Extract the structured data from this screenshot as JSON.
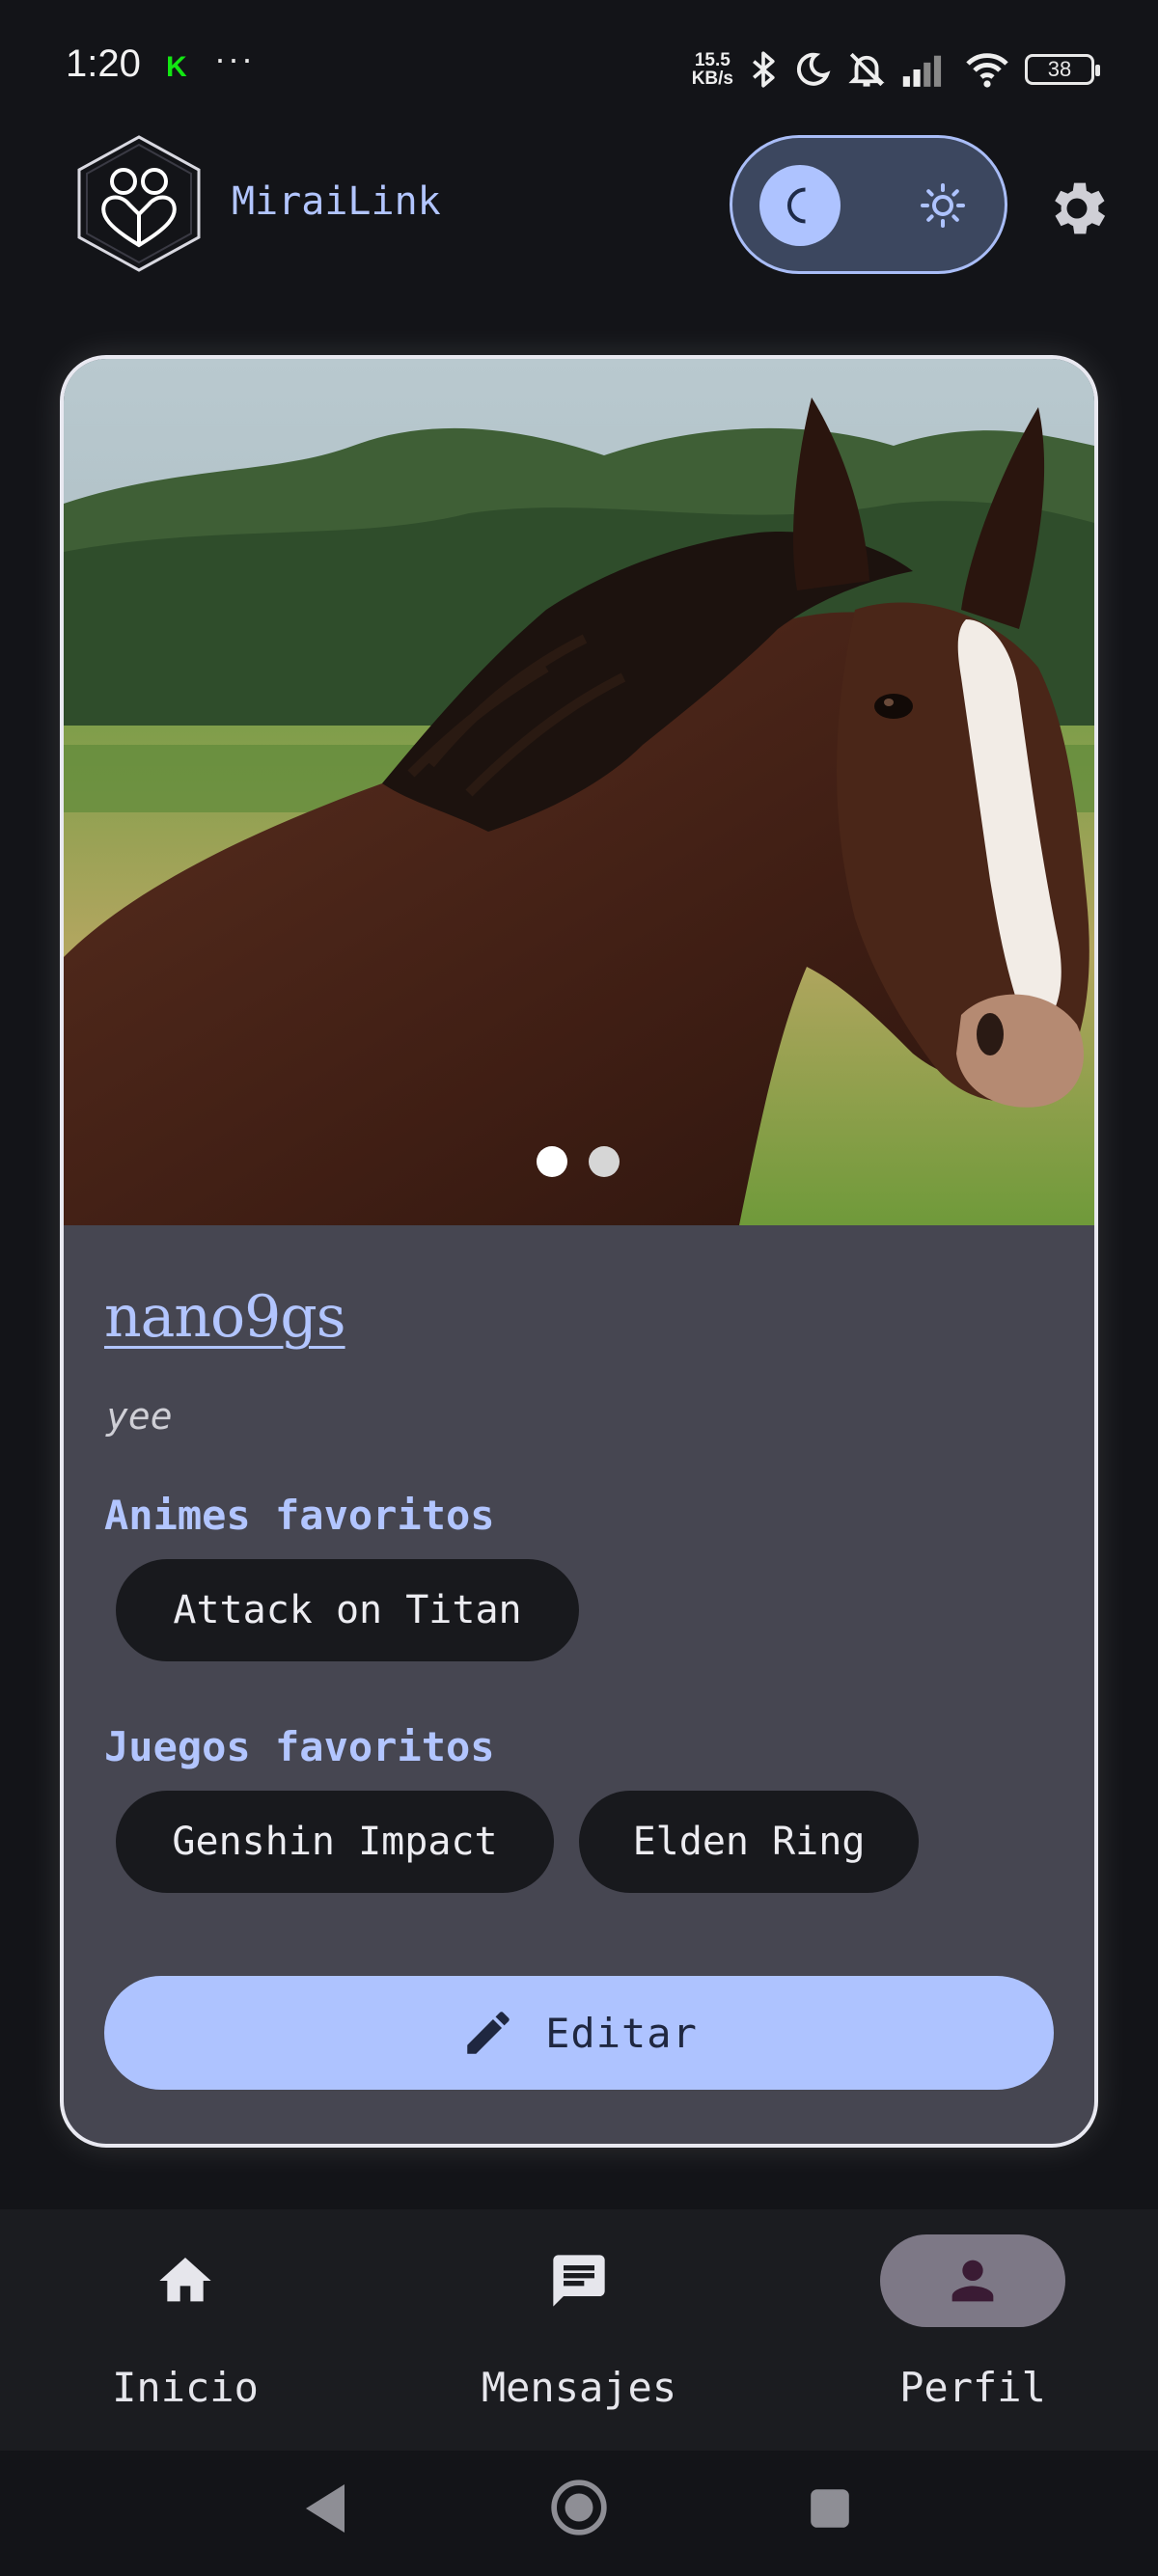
{
  "status_bar": {
    "time": "1:20",
    "notification_icon": "K",
    "more": "···",
    "net_speed_top": "15.5",
    "net_speed_bottom": "KB/s",
    "battery": "38"
  },
  "app_bar": {
    "title": "MiraiLink",
    "logo_icon": "couple-heart-hexagon-icon",
    "theme_toggle": {
      "selected": "dark",
      "icons": [
        "moon-icon",
        "sun-icon"
      ]
    },
    "settings_icon": "gear-icon"
  },
  "profile": {
    "username": "nano9gs",
    "bio": "yee",
    "photo_pager": {
      "count": 2,
      "current": 1
    },
    "animes_label": "Animes favoritos",
    "animes": [
      "Attack on Titan"
    ],
    "games_label": "Juegos favoritos",
    "games": [
      "Genshin Impact",
      "Elden Ring"
    ],
    "edit_label": "Editar"
  },
  "bottom_nav": {
    "items": [
      {
        "label": "Inicio",
        "icon": "home-icon"
      },
      {
        "label": "Mensajes",
        "icon": "chat-icon"
      },
      {
        "label": "Perfil",
        "icon": "person-icon",
        "selected": true
      }
    ]
  },
  "colors": {
    "accent": "#aec3ff",
    "background": "#131418",
    "card": "#464651",
    "chip": "#18191d"
  }
}
